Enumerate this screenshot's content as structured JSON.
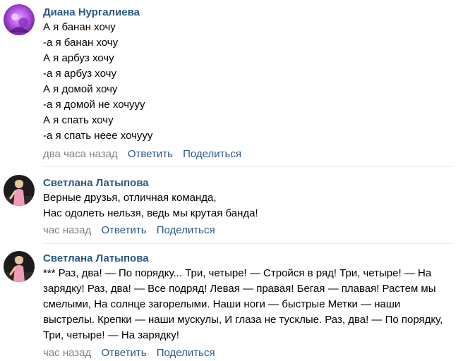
{
  "comments": [
    {
      "author": "Диана Нургалиева",
      "lines": [
        "А я банан хочу",
        "-а я банан хочу",
        "А я арбуз хочу",
        "-а я арбуз хочу",
        "А я домой хочу",
        "-а я домой не хочууу",
        "А я спать хочу",
        "-а я спать неее хочууу"
      ],
      "date": "два часа назад",
      "reply_label": "Ответить",
      "share_label": "Поделиться"
    },
    {
      "author": "Светлана Латыпова",
      "lines": [
        "Верные друзья, отличная команда,",
        "Нас одолеть нельзя, ведь мы крутая банда!"
      ],
      "date": "час назад",
      "reply_label": "Ответить",
      "share_label": "Поделиться"
    },
    {
      "author": "Светлана Латыпова",
      "paragraph": "*** Раз, два! — По порядку... Три, четыре! — Стройся в ряд! Три, четыре! — На зарядку! Раз, два! — Все подряд! Левая — правая! Бегая — плавая! Растем мы смелыми, На солнце загорелыми. Наши ноги — быстрые Метки — наши выстрелы. Крепки — наши мускулы, И глаза не тусклые. Раз, два! — По порядку, Три, четыре! — На зарядку!",
      "date": "час назад",
      "reply_label": "Ответить",
      "share_label": "Поделиться"
    }
  ],
  "colors": {
    "author_link": "#2a5885",
    "meta_gray": "#828282",
    "divider": "#e7e8ec"
  }
}
